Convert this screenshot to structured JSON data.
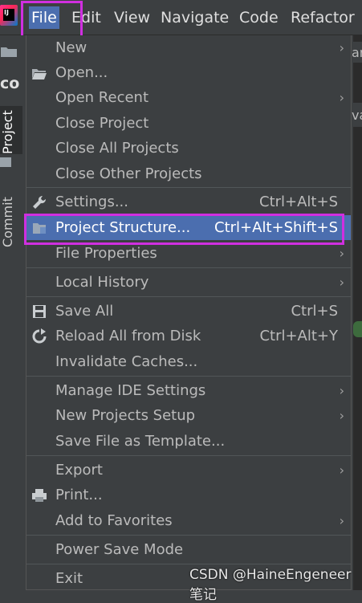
{
  "app": {
    "logo_text": "IJ"
  },
  "menubar": {
    "items": [
      {
        "label": "File",
        "mnemonic": "F"
      },
      {
        "label": "Edit",
        "mnemonic": "E"
      },
      {
        "label": "View",
        "mnemonic": "V"
      },
      {
        "label": "Navigate",
        "mnemonic": "N"
      },
      {
        "label": "Code",
        "mnemonic": "C"
      },
      {
        "label": "Refactor",
        "mnemonic": "R"
      }
    ]
  },
  "sidebar": {
    "top_label": "co",
    "tabs": [
      {
        "label": "Project"
      },
      {
        "label": "Commit"
      }
    ]
  },
  "file_menu": {
    "items": [
      {
        "label": "New",
        "shortcut": "",
        "submenu": true,
        "icon": ""
      },
      {
        "label": "Open...",
        "shortcut": "",
        "submenu": false,
        "icon": "folder-open-icon"
      },
      {
        "label": "Open Recent",
        "shortcut": "",
        "submenu": true,
        "icon": ""
      },
      {
        "label": "Close Project",
        "shortcut": "",
        "submenu": false,
        "icon": ""
      },
      {
        "label": "Close All Projects",
        "shortcut": "",
        "submenu": false,
        "icon": ""
      },
      {
        "label": "Close Other Projects",
        "shortcut": "",
        "submenu": false,
        "icon": ""
      },
      {
        "label": "Settings...",
        "shortcut": "Ctrl+Alt+S",
        "submenu": false,
        "icon": "wrench-icon"
      },
      {
        "label": "Project Structure...",
        "shortcut": "Ctrl+Alt+Shift+S",
        "submenu": false,
        "icon": "project-structure-icon",
        "selected": true
      },
      {
        "label": "File Properties",
        "shortcut": "",
        "submenu": true,
        "icon": ""
      },
      {
        "label": "Local History",
        "shortcut": "",
        "submenu": true,
        "icon": ""
      },
      {
        "label": "Save All",
        "shortcut": "Ctrl+S",
        "submenu": false,
        "icon": "save-icon"
      },
      {
        "label": "Reload All from Disk",
        "shortcut": "Ctrl+Alt+Y",
        "submenu": false,
        "icon": "reload-icon"
      },
      {
        "label": "Invalidate Caches...",
        "shortcut": "",
        "submenu": false,
        "icon": ""
      },
      {
        "label": "Manage IDE Settings",
        "shortcut": "",
        "submenu": true,
        "icon": ""
      },
      {
        "label": "New Projects Setup",
        "shortcut": "",
        "submenu": true,
        "icon": ""
      },
      {
        "label": "Save File as Template...",
        "shortcut": "",
        "submenu": false,
        "icon": ""
      },
      {
        "label": "Export",
        "shortcut": "",
        "submenu": true,
        "icon": ""
      },
      {
        "label": "Print...",
        "shortcut": "",
        "submenu": false,
        "icon": "print-icon"
      },
      {
        "label": "Add to Favorites",
        "shortcut": "",
        "submenu": true,
        "icon": ""
      },
      {
        "label": "Power Save Mode",
        "shortcut": "",
        "submenu": false,
        "icon": ""
      },
      {
        "label": "Exit",
        "shortcut": "",
        "submenu": false,
        "icon": ""
      }
    ]
  },
  "background": {
    "tab_text_1": "ar",
    "tab_text_2": "va"
  },
  "watermark": "CSDN @HaineEngeneer笔记",
  "colors": {
    "menu_bg": "#3c3f41",
    "selection": "#4b6eaf",
    "highlight_outline": "#d02fe0",
    "text": "#bbbbbb"
  },
  "arrow_glyph": "›"
}
